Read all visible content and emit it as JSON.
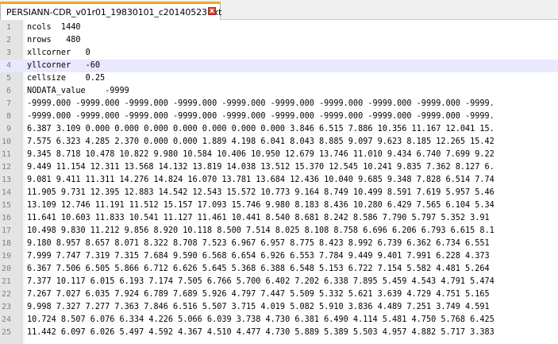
{
  "tab": {
    "filename": "PERSIANN-CDR_v01r01_19830101_c20140523.txt",
    "close_glyph": "x"
  },
  "editor": {
    "current_line": 4,
    "lines": [
      {
        "n": "1",
        "text": "ncols  1440"
      },
      {
        "n": "2",
        "text": "nrows   480"
      },
      {
        "n": "3",
        "text": "xllcorner   0"
      },
      {
        "n": "4",
        "text": "yllcorner   -60"
      },
      {
        "n": "5",
        "text": "cellsize    0.25"
      },
      {
        "n": "6",
        "text": "NODATA_value    -9999"
      },
      {
        "n": "7",
        "text": "-9999.000 -9999.000 -9999.000 -9999.000 -9999.000 -9999.000 -9999.000 -9999.000 -9999.000 -9999."
      },
      {
        "n": "8",
        "text": "-9999.000 -9999.000 -9999.000 -9999.000 -9999.000 -9999.000 -9999.000 -9999.000 -9999.000 -9999."
      },
      {
        "n": "9",
        "text": "6.387 3.109 0.000 0.000 0.000 0.000 0.000 0.000 0.000 3.846 6.515 7.886 10.356 11.167 12.041 15."
      },
      {
        "n": "10",
        "text": "7.575 6.323 4.285 2.370 0.000 0.000 1.889 4.198 6.041 8.043 8.885 9.097 9.623 8.185 12.265 15.42"
      },
      {
        "n": "11",
        "text": "9.345 8.718 10.478 10.822 9.980 10.584 10.406 10.950 12.679 13.746 11.010 9.434 6.740 7.699 9.22"
      },
      {
        "n": "12",
        "text": "9.449 11.154 12.311 13.568 14.132 13.819 14.038 13.512 15.370 12.545 10.241 9.835 7.362 8.127 6."
      },
      {
        "n": "13",
        "text": "9.081 9.411 11.311 14.276 14.824 16.070 13.781 13.684 12.436 10.040 9.685 9.348 7.828 6.514 7.74"
      },
      {
        "n": "14",
        "text": "11.905 9.731 12.395 12.883 14.542 12.543 15.572 10.773 9.164 8.749 10.499 8.591 7.619 5.957 5.46"
      },
      {
        "n": "15",
        "text": "13.109 12.746 11.191 11.512 15.157 17.093 15.746 9.980 8.183 8.436 10.280 6.429 7.565 6.104 5.34"
      },
      {
        "n": "16",
        "text": "11.641 10.603 11.833 10.541 11.127 11.461 10.441 8.540 8.681 8.242 8.586 7.790 5.797 5.352 3.91"
      },
      {
        "n": "17",
        "text": "10.498 9.830 11.212 9.856 8.920 10.118 8.500 7.514 8.025 8.108 8.758 6.696 6.206 6.793 6.615 8.1"
      },
      {
        "n": "18",
        "text": "9.180 8.957 8.657 8.071 8.322 8.708 7.523 6.967 6.957 8.775 8.423 8.992 6.739 6.362 6.734 6.551"
      },
      {
        "n": "19",
        "text": "7.999 7.747 7.319 7.315 7.684 9.590 6.568 6.654 6.926 6.553 7.784 9.449 9.401 7.991 6.228 4.373"
      },
      {
        "n": "20",
        "text": "6.367 7.506 6.505 5.866 6.712 6.626 5.645 5.368 6.388 6.548 5.153 6.722 7.154 5.582 4.481 5.264"
      },
      {
        "n": "21",
        "text": "7.377 10.117 6.015 6.193 7.174 7.505 6.766 5.700 6.402 7.202 6.338 7.895 5.459 4.543 4.791 5.474"
      },
      {
        "n": "22",
        "text": "7.267 7.027 6.035 7.924 6.789 7.689 5.926 4.797 7.447 5.509 5.332 5.621 3.639 4.729 4.751 5.165"
      },
      {
        "n": "23",
        "text": "9.998 7.327 7.277 7.363 7.846 6.516 5.507 3.715 4.019 5.082 5.910 3.836 4.489 7.251 3.749 4.591"
      },
      {
        "n": "24",
        "text": "10.724 8.507 6.076 6.334 4.226 5.066 6.039 3.738 4.730 6.381 6.490 4.114 5.481 4.750 5.768 6.425"
      },
      {
        "n": "25",
        "text": "11.442 6.097 6.026 5.497 4.592 4.367 4.510 4.477 4.730 5.889 5.389 5.503 4.957 4.882 5.717 3.383"
      }
    ]
  }
}
